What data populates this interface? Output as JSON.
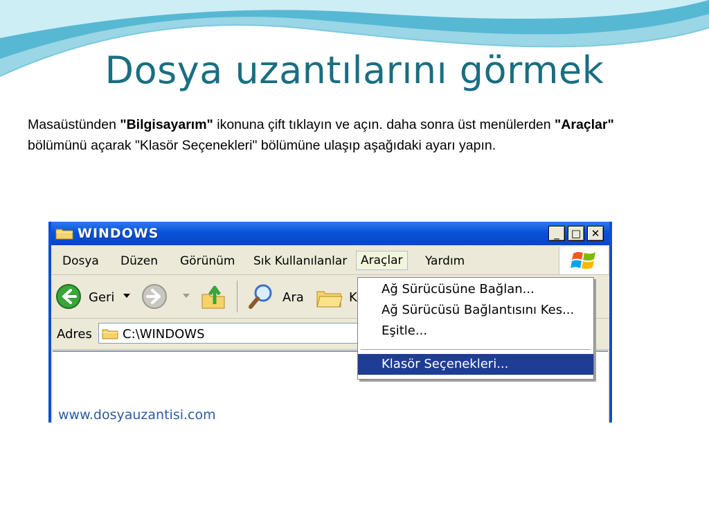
{
  "slide": {
    "title": "Dosya uzantılarını görmek",
    "paragraph": {
      "p1": "Masaüstünden ",
      "b1": "\"Bilgisayarım\"",
      "p2": " ikonuna çift tıklayın ve açın. daha sonra üst menülerden ",
      "b2": "\"Araçlar\"",
      "p3": " bölümünü açarak \"Klasör Seçenekleri\" bölümüne ulaşıp aşağıdaki ayarı yapın."
    }
  },
  "window": {
    "title": "WINDOWS",
    "controls": {
      "minimize": "_",
      "maximize": "□",
      "close": "✕"
    },
    "menu": [
      "Dosya",
      "Düzen",
      "Görünüm",
      "Sık Kullanılanlar",
      "Araçlar",
      "Yardım"
    ],
    "toolbar": {
      "back": "Geri",
      "search": "Ara",
      "partial": "K"
    },
    "address": {
      "label": "Adres",
      "value": "C:\\WINDOWS"
    },
    "dropdown": [
      "Ağ Sürücüsüne Bağlan...",
      "Ağ Sürücüsü Bağlantısını Kes...",
      "Eşitle...",
      "Klasör Seçenekleri..."
    ],
    "watermark": "www.dosyauzantisi.com"
  },
  "colors": {
    "title": "#1a6e80",
    "xp_blue": "#0a52d8",
    "highlight": "#1f3d94"
  },
  "icons": [
    "folder-icon",
    "back-arrow-icon",
    "forward-arrow-icon",
    "up-folder-icon",
    "search-icon",
    "folders-icon",
    "windows-flag-icon"
  ]
}
